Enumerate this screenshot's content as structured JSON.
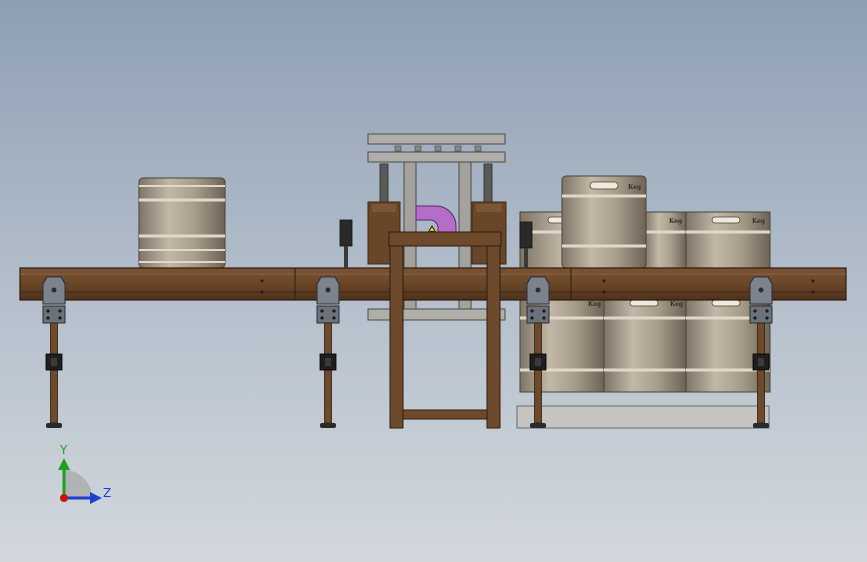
{
  "viewport": {
    "background": [
      "#8e9fb4",
      "#d2d7dc"
    ]
  },
  "triad": {
    "y_label": "Y",
    "z_label": "Z",
    "y_color": "#1fa01f",
    "z_color": "#1f3fd0",
    "origin_color": "#d01010",
    "x_arc_color": "#9a9a9a"
  },
  "colors": {
    "frame_wood": "#6e4a2c",
    "frame_wood_dark": "#3e2816",
    "keg_body": "#a59a88",
    "keg_band": "#d6cfc2",
    "steel": "#9a9a96",
    "clamp_purple": "#b46ec8",
    "sensor": "#2a2a2a",
    "base_plate": "#c6c4c0"
  },
  "keg_labels": [
    "Keg",
    "Keg",
    "Keg",
    "Keg",
    "Keg",
    "Keg"
  ]
}
